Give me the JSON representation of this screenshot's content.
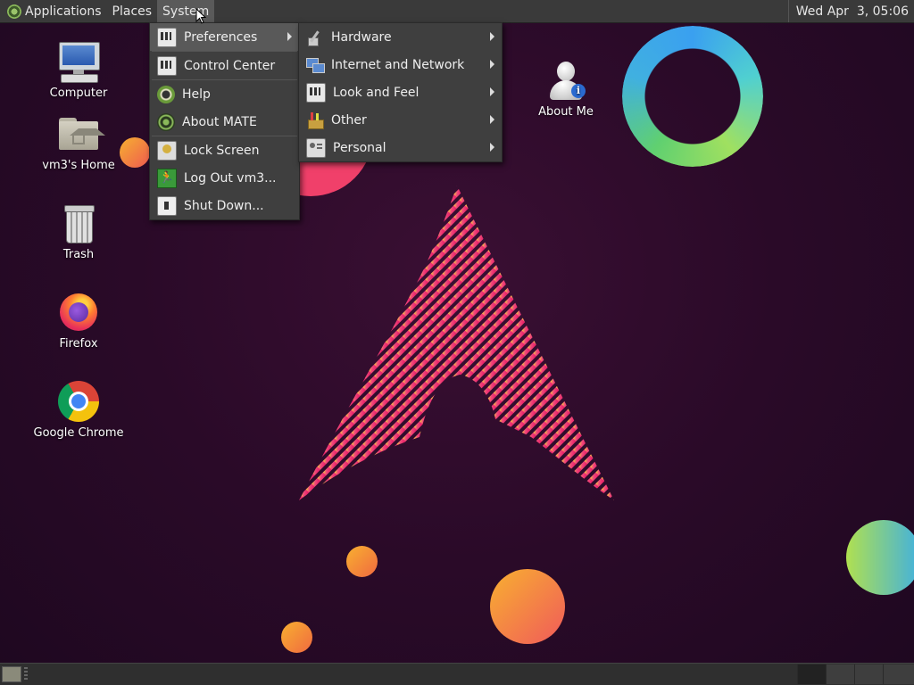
{
  "top_panel": {
    "menus": [
      {
        "label": "Applications",
        "icon": "mate-logo-icon"
      },
      {
        "label": "Places"
      },
      {
        "label": "System"
      }
    ],
    "clock": "Wed Apr  3, 05:06"
  },
  "desktop_icons": [
    {
      "label": "Computer",
      "icon": "computer-icon"
    },
    {
      "label": "vm3's Home",
      "icon": "home-folder-icon"
    },
    {
      "label": "Trash",
      "icon": "trash-icon"
    },
    {
      "label": "Firefox",
      "icon": "firefox-icon"
    },
    {
      "label": "Google Chrome",
      "icon": "chrome-icon"
    },
    {
      "label": "About Me",
      "icon": "about-me-icon"
    }
  ],
  "system_menu": {
    "items": [
      {
        "label": "Preferences",
        "icon": "preferences-icon",
        "submenu": true
      },
      {
        "label": "Control Center",
        "icon": "control-center-icon"
      },
      {
        "label": "Help",
        "icon": "help-icon"
      },
      {
        "label": "About MATE",
        "icon": "about-mate-icon"
      },
      {
        "label": "Lock Screen",
        "icon": "lock-screen-icon"
      },
      {
        "label": "Log Out vm3...",
        "icon": "log-out-icon"
      },
      {
        "label": "Shut Down...",
        "icon": "shut-down-icon"
      }
    ]
  },
  "preferences_submenu": {
    "items": [
      {
        "label": "Hardware",
        "icon": "hardware-icon"
      },
      {
        "label": "Internet and Network",
        "icon": "network-icon"
      },
      {
        "label": "Look and Feel",
        "icon": "look-and-feel-icon"
      },
      {
        "label": "Other",
        "icon": "other-icon"
      },
      {
        "label": "Personal",
        "icon": "personal-icon"
      }
    ]
  },
  "colors": {
    "panel": "#3a3a3a",
    "menu_bg": "#3f3f3f",
    "menu_highlight": "#595959",
    "wallpaper": "#2a0a28",
    "accent_pink": "#e8306a",
    "accent_orange": "#f5a030"
  }
}
